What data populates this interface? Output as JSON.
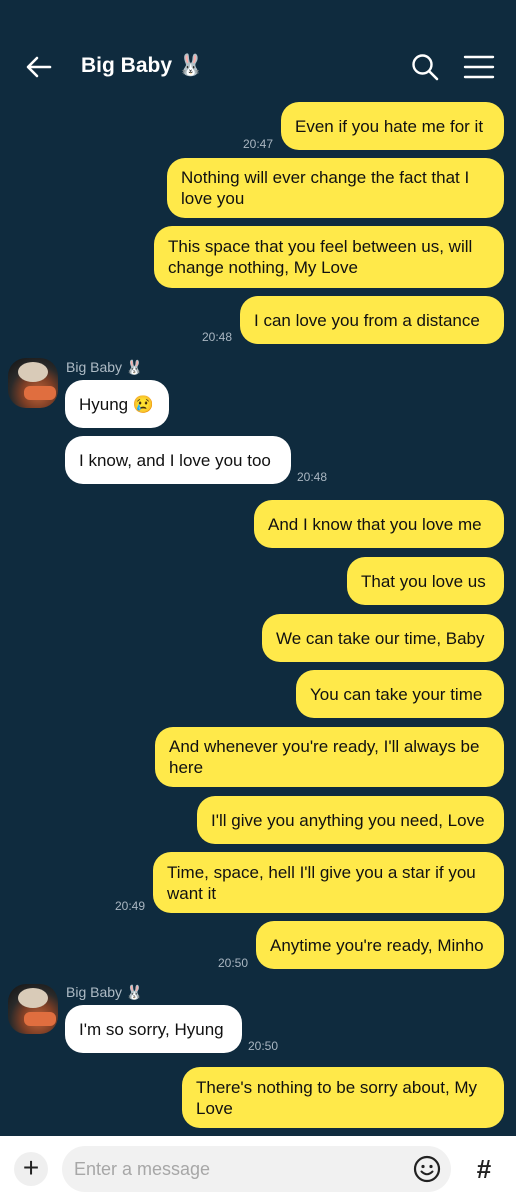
{
  "header": {
    "title": "Big Baby 🐰"
  },
  "sender_name": "Big Baby 🐰",
  "messages": [
    {
      "text": "Even if you hate me for it",
      "time": "20:47"
    },
    {
      "text": "Nothing will ever change the fact that I love you"
    },
    {
      "text": "This space that you feel between us, will change nothing, My Love"
    },
    {
      "text": "I can love you from a distance",
      "time": "20:48"
    },
    {
      "text": "Hyung 😢"
    },
    {
      "text": "I know, and I love you too",
      "time": "20:48"
    },
    {
      "text": "And I know that you love me"
    },
    {
      "text": "That you love us"
    },
    {
      "text": "We can take our time, Baby"
    },
    {
      "text": "You can take your time"
    },
    {
      "text": "And whenever you're ready, I'll always be here"
    },
    {
      "text": "I'll give you anything you need, Love"
    },
    {
      "text": "Time, space, hell I'll give you a star if you want it",
      "time": "20:49"
    },
    {
      "text": "Anytime you're ready, Minho",
      "time": "20:50"
    },
    {
      "text": "I'm so sorry, Hyung",
      "time": "20:50"
    },
    {
      "text": "There's nothing to be sorry about, My Love"
    }
  ],
  "input": {
    "placeholder": "Enter a message"
  },
  "footer": {
    "plus_label": "+",
    "hash_label": "#"
  },
  "colors": {
    "background": "#0f2b3e",
    "outgoing": "#ffe94a",
    "incoming": "#ffffff"
  }
}
